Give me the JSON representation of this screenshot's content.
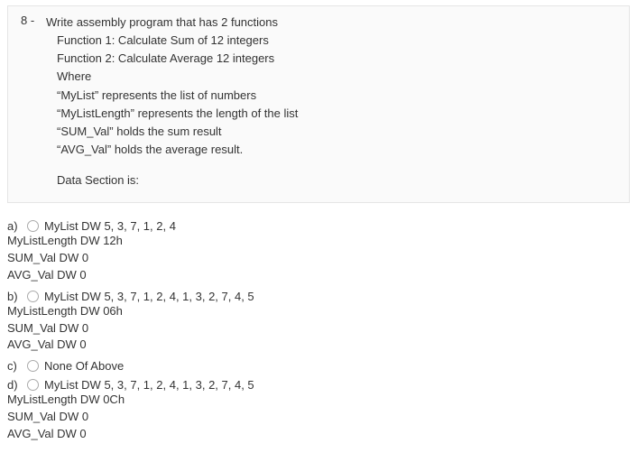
{
  "question": {
    "number": "8 -",
    "lines": [
      "Write assembly program that has 2 functions",
      "Function 1: Calculate Sum of 12 integers",
      "Function 2: Calculate Average 12 integers",
      "Where",
      "“MyList” represents the list of numbers",
      "“MyListLength” represents the length of the list",
      "“SUM_Val” holds the sum result",
      "“AVG_Val” holds the average result."
    ],
    "data_section_label": "Data Section is:"
  },
  "options": {
    "a": {
      "letter": "a)",
      "first": "MyList DW 5, 3, 7, 1, 2, 4",
      "rest": [
        "MyListLength DW 12h",
        "SUM_Val DW 0",
        "AVG_Val DW 0"
      ]
    },
    "b": {
      "letter": "b)",
      "first": "MyList DW 5, 3, 7, 1, 2, 4, 1, 3, 2, 7, 4, 5",
      "rest": [
        "MyListLength DW 06h",
        "SUM_Val DW 0",
        "AVG_Val DW 0"
      ]
    },
    "c": {
      "letter": "c)",
      "first": "None Of Above",
      "rest": []
    },
    "d": {
      "letter": "d)",
      "first": "MyList DW 5, 3, 7, 1, 2, 4, 1, 3, 2, 7, 4, 5",
      "rest": [
        "MyListLength DW 0Ch",
        "SUM_Val DW 0",
        "AVG_Val DW 0"
      ]
    }
  }
}
